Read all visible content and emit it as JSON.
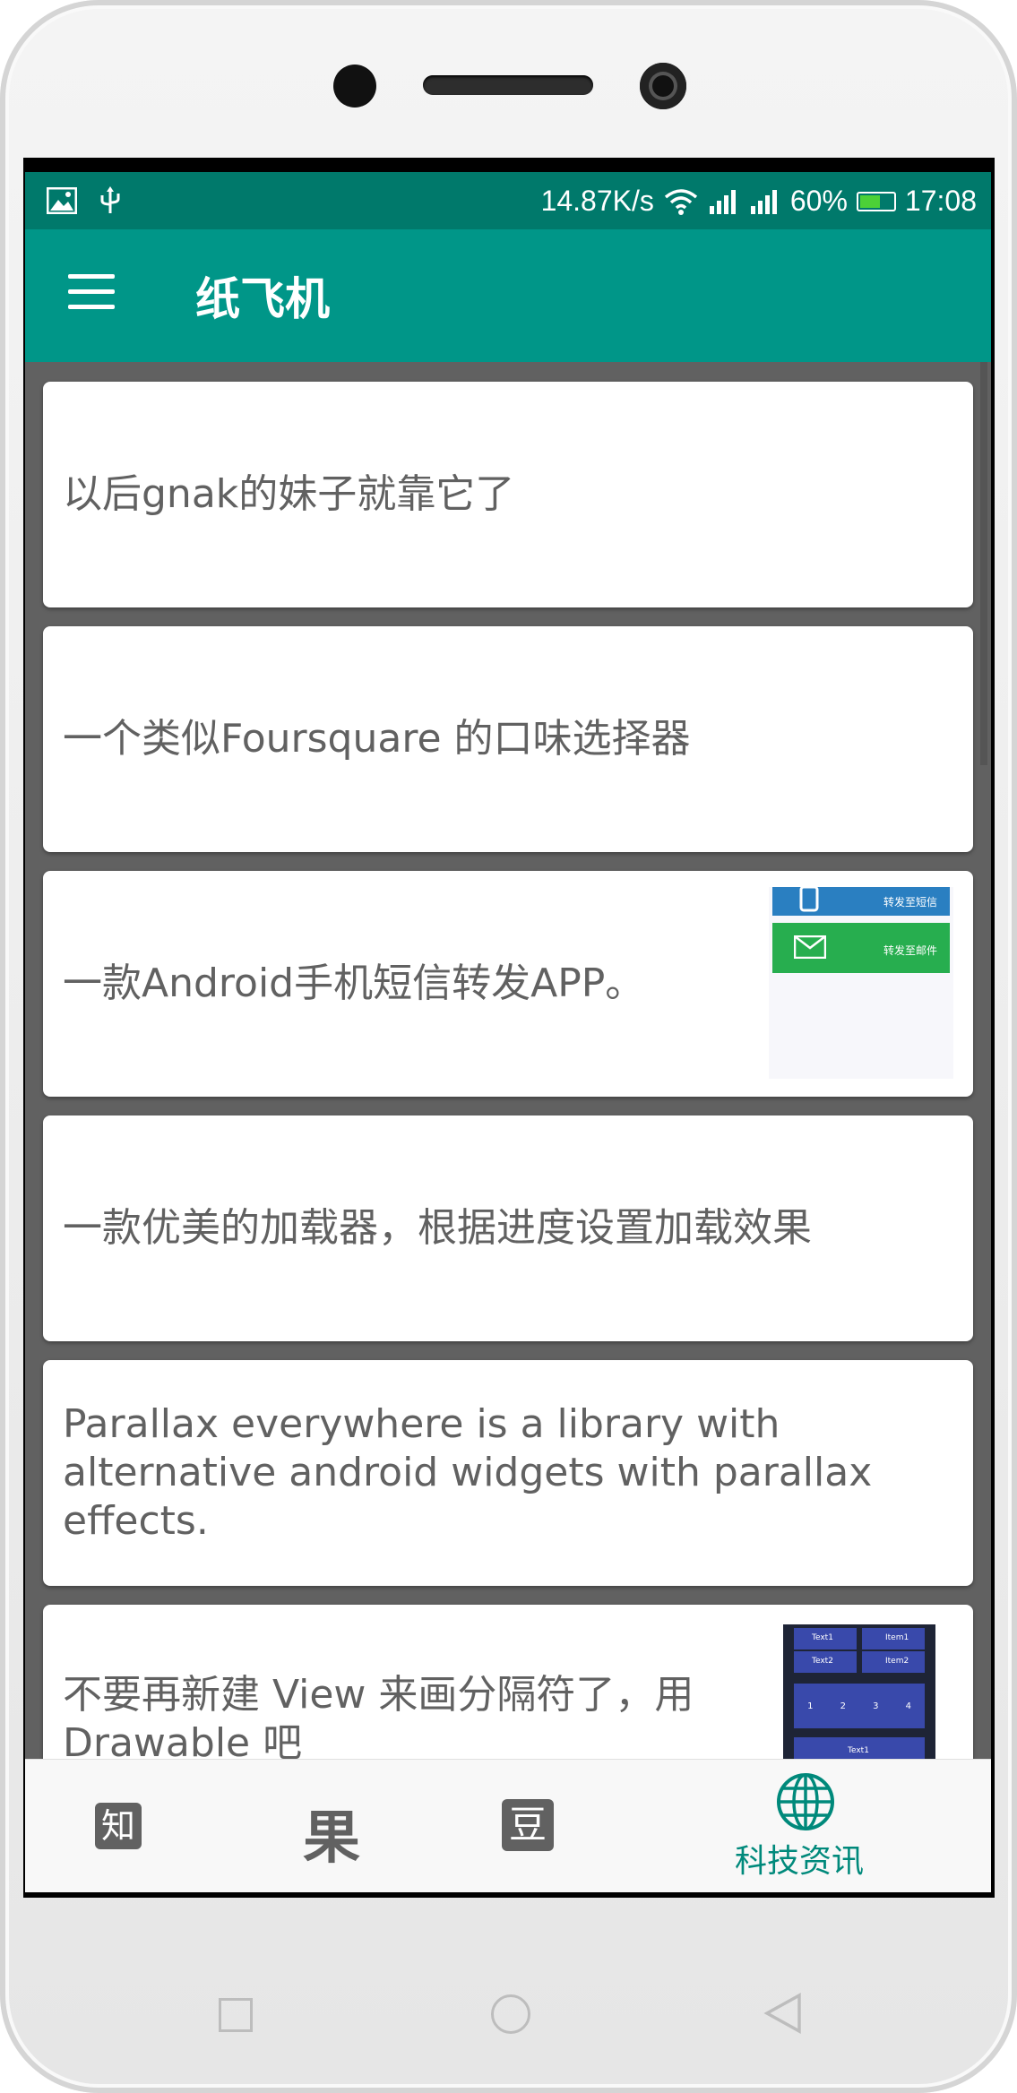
{
  "status_bar": {
    "network_speed": "14.87K/s",
    "battery_level": "60%",
    "battery_fraction": 0.6,
    "time": "17:08",
    "icons": [
      "image-icon",
      "usb-icon",
      "wifi-icon",
      "signal-icon",
      "signal-icon",
      "battery-icon"
    ]
  },
  "toolbar": {
    "title": "纸飞机",
    "menu_icon": "hamburger-menu-icon"
  },
  "feed": {
    "items": [
      {
        "title": "以后gnak的妹子就靠它了"
      },
      {
        "title": "一个类似Foursquare 的口味选择器"
      },
      {
        "title": "一款Android手机短信转发APP。",
        "thumbnail": {
          "label_1": "转发至短信",
          "label_2": "转发至邮件"
        }
      },
      {
        "title": "一款优美的加载器，根据进度设置加载效果"
      },
      {
        "title": "Parallax everywhere is a library with alternative android widgets with parallax effects."
      },
      {
        "title": "不要再新建 View 来画分隔符了，用 Drawable 吧",
        "thumbnail": {
          "label_1": "Text1",
          "label_2": "Item1",
          "label_3": "Text2",
          "label_4": "Item2",
          "label_5": "Text1",
          "digits": [
            "1",
            "2",
            "3",
            "4"
          ]
        }
      }
    ]
  },
  "bottom_nav": {
    "items": [
      {
        "glyph": "知",
        "icon": "zhihu-icon"
      },
      {
        "glyph": "果",
        "icon": "guokr-icon"
      },
      {
        "glyph": "豆",
        "icon": "douban-icon"
      },
      {
        "label": "科技资讯",
        "icon": "globe-icon",
        "active": true
      }
    ]
  },
  "colors": {
    "primary": "#009688",
    "primary_dark": "#00796b",
    "background": "#616161",
    "accent_text": "#00897b"
  }
}
